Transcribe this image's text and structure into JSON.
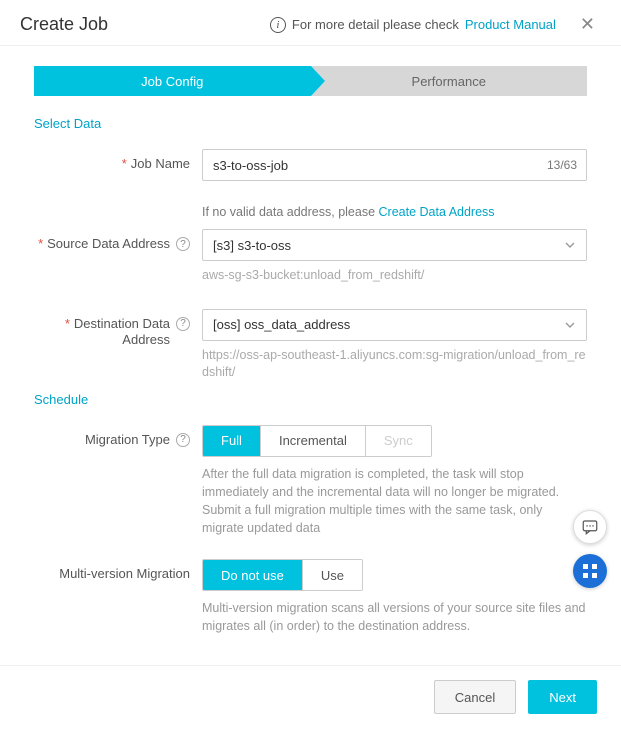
{
  "header": {
    "title": "Create Job",
    "hint_prefix": "For more detail please check ",
    "hint_link": "Product Manual"
  },
  "tabs": {
    "active": "Job Config",
    "inactive": "Performance"
  },
  "sections": {
    "select_data": "Select Data",
    "schedule": "Schedule"
  },
  "jobName": {
    "label": "Job Name",
    "value": "s3-to-oss-job",
    "counter": "13/63"
  },
  "sourceAddr": {
    "hint_prefix": "If no valid data address, please ",
    "hint_link": "Create Data Address",
    "label": "Source Data Address",
    "value": "[s3] s3-to-oss",
    "sub": "aws-sg-s3-bucket:unload_from_redshift/"
  },
  "destAddr": {
    "label_line1": "Destination Data",
    "label_line2": "Address",
    "value": "[oss] oss_data_address",
    "sub": "https://oss-ap-southeast-1.aliyuncs.com:sg-migration/unload_from_redshift/"
  },
  "migrationType": {
    "label": "Migration Type",
    "opts": {
      "full": "Full",
      "incremental": "Incremental",
      "sync": "Sync"
    },
    "desc": "After the full data migration is completed, the task will stop immediately and the incremental data will no longer be migrated. Submit a full migration multiple times with the same task, only migrate updated data"
  },
  "multiVersion": {
    "label": "Multi-version Migration",
    "opts": {
      "no": "Do not use",
      "yes": "Use"
    },
    "desc": "Multi-version migration scans all versions of your source site files and migrates all (in order) to the destination address."
  },
  "footer": {
    "cancel": "Cancel",
    "next": "Next"
  }
}
